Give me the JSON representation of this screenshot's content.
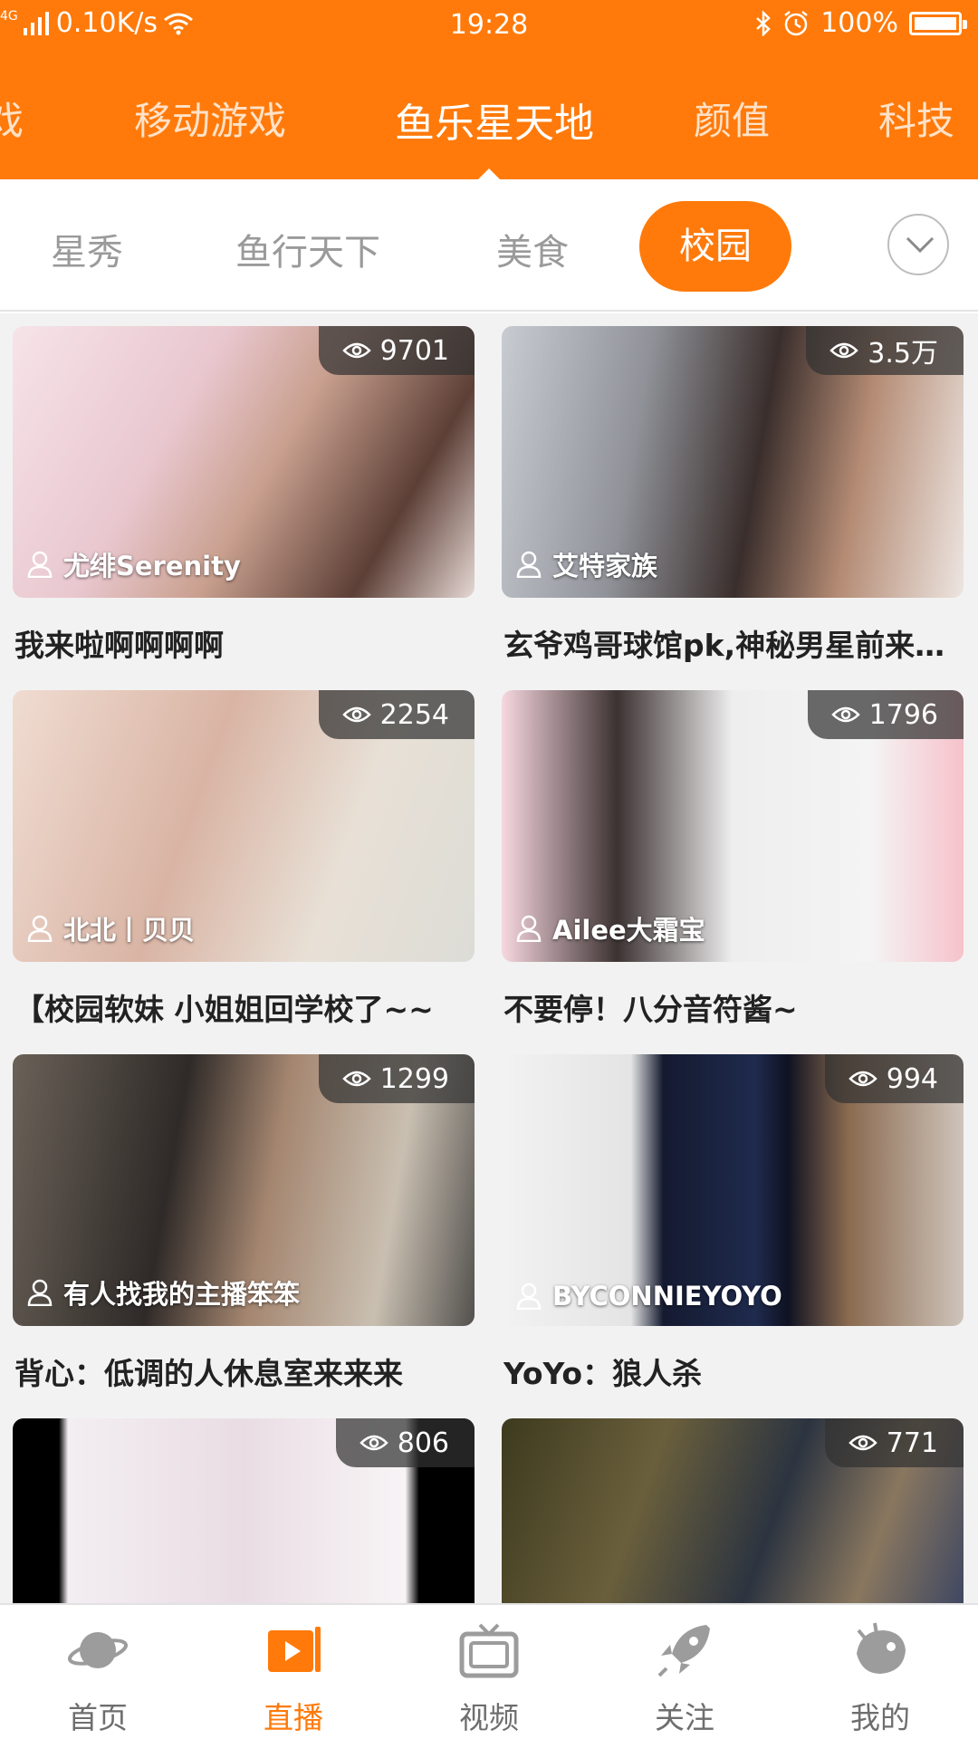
{
  "status_bar": {
    "network": "4G",
    "speed": "0.10K/s",
    "time": "19:28",
    "battery": "100%"
  },
  "top_tabs": {
    "items": [
      {
        "label": "戏"
      },
      {
        "label": "移动游戏"
      },
      {
        "label": "鱼乐星天地"
      },
      {
        "label": "颜值"
      },
      {
        "label": "科技"
      }
    ],
    "active_index": 2
  },
  "sub_tabs": {
    "items": [
      {
        "label": "星秀"
      },
      {
        "label": "鱼行天下"
      },
      {
        "label": "美食"
      },
      {
        "label": "校园"
      }
    ],
    "active_index": 3
  },
  "rooms": [
    {
      "viewers": "9701",
      "anchor": "尤绯Serenity",
      "title": "我来啦啊啊啊啊"
    },
    {
      "viewers": "3.5万",
      "anchor": "艾特家族",
      "title": "玄爷鸡哥球馆pk,神秘男星前来…"
    },
    {
      "viewers": "2254",
      "anchor": "北北丨贝贝",
      "title": "【校园软妹 小姐姐回学校了~~"
    },
    {
      "viewers": "1796",
      "anchor": "Ailee大霜宝",
      "title": "不要停！八分音符酱~"
    },
    {
      "viewers": "1299",
      "anchor": "有人找我的主播笨笨",
      "title": "背心：低调的人休息室来来来"
    },
    {
      "viewers": "994",
      "anchor": "BYCONNIEYOYO",
      "title": "YoYo：狼人杀"
    },
    {
      "viewers": "806",
      "anchor": "",
      "title": ""
    },
    {
      "viewers": "771",
      "anchor": "",
      "title": ""
    }
  ],
  "bottom_nav": {
    "items": [
      {
        "label": "首页",
        "icon": "planet-icon"
      },
      {
        "label": "直播",
        "icon": "live-play-icon"
      },
      {
        "label": "视频",
        "icon": "tv-icon"
      },
      {
        "label": "关注",
        "icon": "rocket-icon"
      },
      {
        "label": "我的",
        "icon": "fish-icon"
      }
    ],
    "active_index": 1
  },
  "colors": {
    "accent": "#ff7a0a",
    "inactive_text": "#9a9a9a"
  }
}
